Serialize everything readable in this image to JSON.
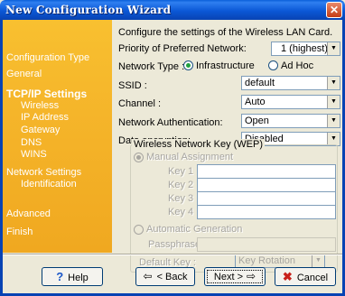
{
  "window": {
    "title": "New Configuration Wizard",
    "close_icon": "close-x-icon"
  },
  "sidebar": {
    "items": [
      {
        "label": "Configuration Type",
        "level": 0
      },
      {
        "label": "General",
        "level": 0
      },
      {
        "label": "TCP/IP Settings",
        "level": 0,
        "active": true
      },
      {
        "label": "Wireless",
        "level": 1
      },
      {
        "label": "IP Address",
        "level": 1
      },
      {
        "label": "Gateway",
        "level": 1
      },
      {
        "label": "DNS",
        "level": 1
      },
      {
        "label": "WINS",
        "level": 1
      },
      {
        "label": "Network Settings",
        "level": 0
      },
      {
        "label": "Identification",
        "level": 1
      },
      {
        "label": "Advanced",
        "level": 0
      },
      {
        "label": "Finish",
        "level": 0
      }
    ]
  },
  "main": {
    "intro": "Configure the settings of the Wireless LAN Card.",
    "priority": {
      "label": "Priority of Preferred Network:",
      "value": "1 (highest)"
    },
    "network_type": {
      "label": "Network Type :",
      "options": [
        "Infrastructure",
        "Ad Hoc"
      ],
      "selected": "Infrastructure"
    },
    "ssid": {
      "label": "SSID :",
      "value": "default"
    },
    "channel": {
      "label": "Channel :",
      "value": "Auto"
    },
    "auth": {
      "label": "Network Authentication:",
      "value": "Open"
    },
    "encryption": {
      "label": "Data encryption:",
      "value": "Disabled"
    },
    "wep": {
      "group_title": "Wireless Network Key (WEP)",
      "manual_label": "Manual Assignment",
      "key_labels": [
        "Key 1 :",
        "Key 2 :",
        "Key 3 :",
        "Key 4 :"
      ],
      "auto_label": "Automatic Generation",
      "passphrase_label": "Passphrase :",
      "default_key_label": "Default Key :",
      "default_key_value": "Key Rotation"
    }
  },
  "footer": {
    "help": "Help",
    "back": "< Back",
    "next": "Next >",
    "cancel": "Cancel"
  }
}
